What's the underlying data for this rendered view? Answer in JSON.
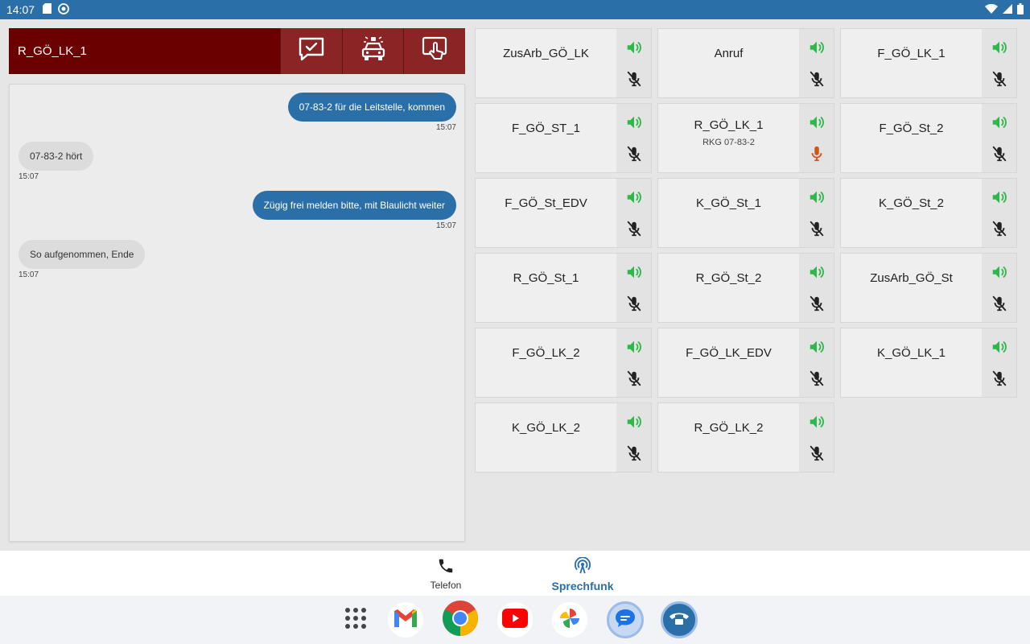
{
  "status_bar": {
    "time": "14:07"
  },
  "channel_header": {
    "name": "R_GÖ_LK_1",
    "buttons": [
      "message-check-icon",
      "police-car-icon",
      "touch-screen-icon"
    ]
  },
  "chat": {
    "messages": [
      {
        "direction": "out",
        "text": "07-83-2 für die Leitstelle, kommen",
        "time": "15:07"
      },
      {
        "direction": "in",
        "text": "07-83-2 hört",
        "time": "15:07"
      },
      {
        "direction": "out",
        "text": "Zügig frei melden bitte, mit Blaulicht weiter",
        "time": "15:07"
      },
      {
        "direction": "in",
        "text": "So aufgenommen, Ende",
        "time": "15:07"
      }
    ]
  },
  "channels": [
    {
      "name": "ZusArb_GÖ_LK",
      "sub": "",
      "mic_active": false
    },
    {
      "name": "Anruf",
      "sub": "",
      "mic_active": false
    },
    {
      "name": "F_GÖ_LK_1",
      "sub": "",
      "mic_active": false
    },
    {
      "name": "F_GÖ_ST_1",
      "sub": "",
      "mic_active": false
    },
    {
      "name": "R_GÖ_LK_1",
      "sub": "RKG 07-83-2",
      "mic_active": true
    },
    {
      "name": "F_GÖ_St_2",
      "sub": "",
      "mic_active": false
    },
    {
      "name": "F_GÖ_St_EDV",
      "sub": "",
      "mic_active": false
    },
    {
      "name": "K_GÖ_St_1",
      "sub": "",
      "mic_active": false
    },
    {
      "name": "K_GÖ_St_2",
      "sub": "",
      "mic_active": false
    },
    {
      "name": "R_GÖ_St_1",
      "sub": "",
      "mic_active": false
    },
    {
      "name": "R_GÖ_St_2",
      "sub": "",
      "mic_active": false
    },
    {
      "name": "ZusArb_GÖ_St",
      "sub": "",
      "mic_active": false
    },
    {
      "name": "F_GÖ_LK_2",
      "sub": "",
      "mic_active": false
    },
    {
      "name": "F_GÖ_LK_EDV",
      "sub": "",
      "mic_active": false
    },
    {
      "name": "K_GÖ_LK_1",
      "sub": "",
      "mic_active": false
    },
    {
      "name": "K_GÖ_LK_2",
      "sub": "",
      "mic_active": false
    },
    {
      "name": "R_GÖ_LK_2",
      "sub": "",
      "mic_active": false
    }
  ],
  "bottom_nav": {
    "telefon": "Telefon",
    "sprechfunk": "Sprechfunk",
    "active": "sprechfunk"
  },
  "dock": [
    "app-drawer-icon",
    "gmail-icon",
    "chrome-icon",
    "youtube-icon",
    "photos-icon",
    "messages-icon",
    "radio-app-icon"
  ],
  "colors": {
    "status_bar": "#2a6fa8",
    "header_dark_red": "#6b0000",
    "header_button_red": "#8b2525",
    "speaker_green": "#2db84a",
    "mic_active_orange": "#d2541a",
    "outgoing_bubble": "#2a6fa8",
    "incoming_bubble": "#dcdcdc"
  }
}
